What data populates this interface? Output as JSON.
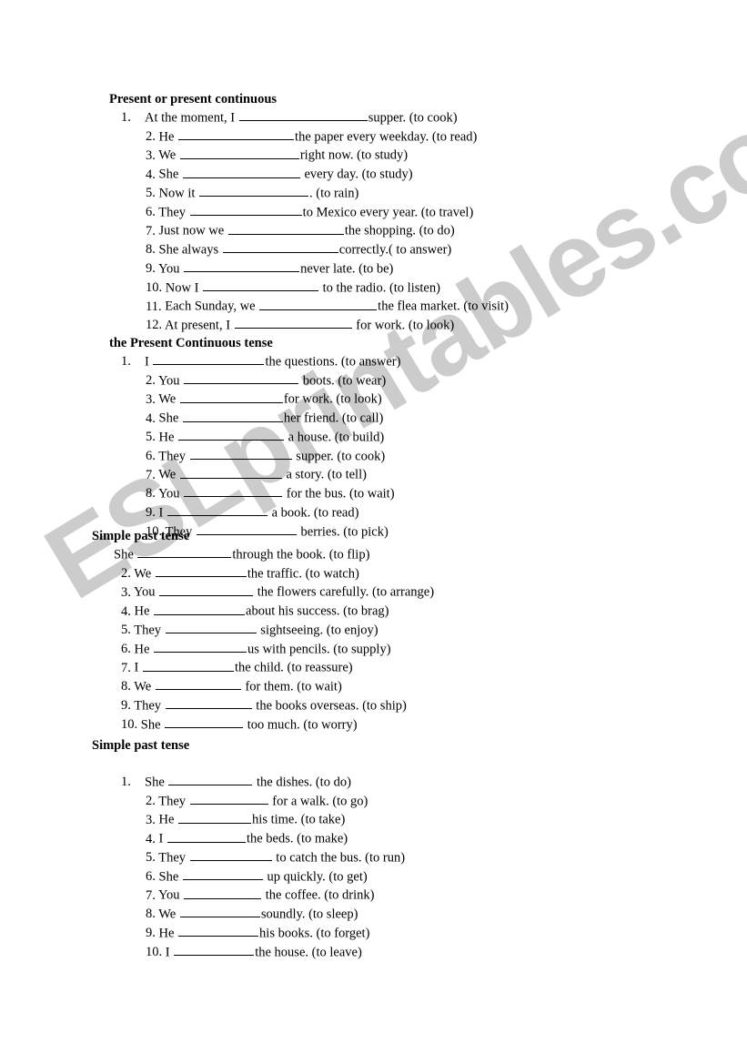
{
  "watermark": {
    "text": "ESLprintables.com",
    "color": "#cccccc"
  },
  "page": {
    "background": "#ffffff",
    "text_color": "#000000"
  },
  "sections": [
    {
      "heading": "Present or present continuous",
      "items": [
        {
          "num": "1.",
          "before": "At the moment, I",
          "blank_width": 141,
          "after": "supper. (to cook)"
        },
        {
          "num": "2.",
          "before": "He",
          "blank_width": 127,
          "after": "the paper every weekday. (to read)"
        },
        {
          "num": "3.",
          "before": "We",
          "blank_width": 131,
          "after": "right now. (to study)"
        },
        {
          "num": "4.",
          "before": "She",
          "blank_width": 129,
          "after": " every day. (to study)"
        },
        {
          "num": "5.",
          "before": "Now it",
          "blank_width": 120,
          "after": ". (to rain)"
        },
        {
          "num": "6.",
          "before": "They",
          "blank_width": 123,
          "after": "to Mexico every year. (to travel)"
        },
        {
          "num": "7.",
          "before": "Just now we",
          "blank_width": 127,
          "after": "the shopping. (to do)"
        },
        {
          "num": "8.",
          "before": "She always",
          "blank_width": 127,
          "after": "correctly.( to answer)"
        },
        {
          "num": "9.",
          "before": "You",
          "blank_width": 127,
          "after": "never late. (to be)"
        },
        {
          "num": "10.",
          "before": "Now I",
          "blank_width": 127,
          "after": " to the radio. (to listen)"
        },
        {
          "num": "11.",
          "before": "Each Sunday, we",
          "blank_width": 129,
          "after": "the flea market. (to visit)"
        },
        {
          "num": "12.",
          "before": "At present, I",
          "blank_width": 129,
          "after": " for work. (to look)"
        }
      ]
    },
    {
      "heading": "the Present Continuous tense",
      "items": [
        {
          "num": "1.",
          "before": "I",
          "blank_width": 122,
          "after": "the questions. (to answer)"
        },
        {
          "num": "2.",
          "before": "You",
          "blank_width": 126,
          "after": " boots. (to wear)"
        },
        {
          "num": "3.",
          "before": "We",
          "blank_width": 113,
          "after": "for work. (to look)"
        },
        {
          "num": "4.",
          "before": "She",
          "blank_width": 110,
          "after": "her friend. (to call)"
        },
        {
          "num": "5.",
          "before": "He",
          "blank_width": 116,
          "after": " a house. (to build)"
        },
        {
          "num": "6.",
          "before": "They",
          "blank_width": 112,
          "after": " supper. (to cook)"
        },
        {
          "num": "7.",
          "before": "We",
          "blank_width": 112,
          "after": " a story. (to tell)"
        },
        {
          "num": "8.",
          "before": "You",
          "blank_width": 108,
          "after": " for the bus. (to wait)"
        },
        {
          "num": "9.",
          "before": "I",
          "blank_width": 110,
          "after": " a book. (to read)"
        },
        {
          "num": "10.",
          "before": "They",
          "blank_width": 110,
          "after": " berries. (to pick)"
        }
      ]
    },
    {
      "heading": "Simple past tense",
      "items": [
        {
          "num": "",
          "before": "She",
          "blank_width": 103,
          "after": "through the book. (to flip)"
        },
        {
          "num": "2.",
          "before": "We",
          "blank_width": 100,
          "after": "the traffic. (to watch)"
        },
        {
          "num": "3.",
          "before": "You",
          "blank_width": 103,
          "after": " the flowers carefully. (to arrange)"
        },
        {
          "num": "4.",
          "before": "He",
          "blank_width": 100,
          "after": "about his success. (to brag)"
        },
        {
          "num": "5.",
          "before": "They",
          "blank_width": 100,
          "after": " sightseeing. (to enjoy)"
        },
        {
          "num": "6.",
          "before": "He",
          "blank_width": 102,
          "after": "us with pencils. (to supply)"
        },
        {
          "num": "7.",
          "before": "I",
          "blank_width": 100,
          "after": "the child. (to reassure)"
        },
        {
          "num": "8.",
          "before": "We",
          "blank_width": 94,
          "after": " for them. (to wait)"
        },
        {
          "num": "9.",
          "before": "They",
          "blank_width": 95,
          "after": " the books overseas. (to ship)"
        },
        {
          "num": "10.",
          "before": "She",
          "blank_width": 86,
          "after": " too much. (to worry)"
        }
      ]
    },
    {
      "heading": "Simple past tense",
      "items": [
        {
          "num": "1.",
          "before": "She",
          "blank_width": 92,
          "after": " the dishes. (to do)"
        },
        {
          "num": "2.",
          "before": "They",
          "blank_width": 86,
          "after": " for a walk. (to go)"
        },
        {
          "num": "3.",
          "before": "He",
          "blank_width": 80,
          "after": "his time. (to take)"
        },
        {
          "num": "4.",
          "before": "I",
          "blank_width": 86,
          "after": "the beds. (to make)"
        },
        {
          "num": "5.",
          "before": "They",
          "blank_width": 90,
          "after": " to catch the bus. (to run)"
        },
        {
          "num": "6.",
          "before": "She",
          "blank_width": 88,
          "after": " up quickly. (to get)"
        },
        {
          "num": "7.",
          "before": "You",
          "blank_width": 85,
          "after": " the coffee. (to drink)"
        },
        {
          "num": "8.",
          "before": "We",
          "blank_width": 88,
          "after": "soundly. (to sleep)"
        },
        {
          "num": "9.",
          "before": "He",
          "blank_width": 88,
          "after": "his books. (to forget)"
        },
        {
          "num": "10.",
          "before": "I",
          "blank_width": 88,
          "after": "the house. (to leave)"
        }
      ]
    }
  ]
}
